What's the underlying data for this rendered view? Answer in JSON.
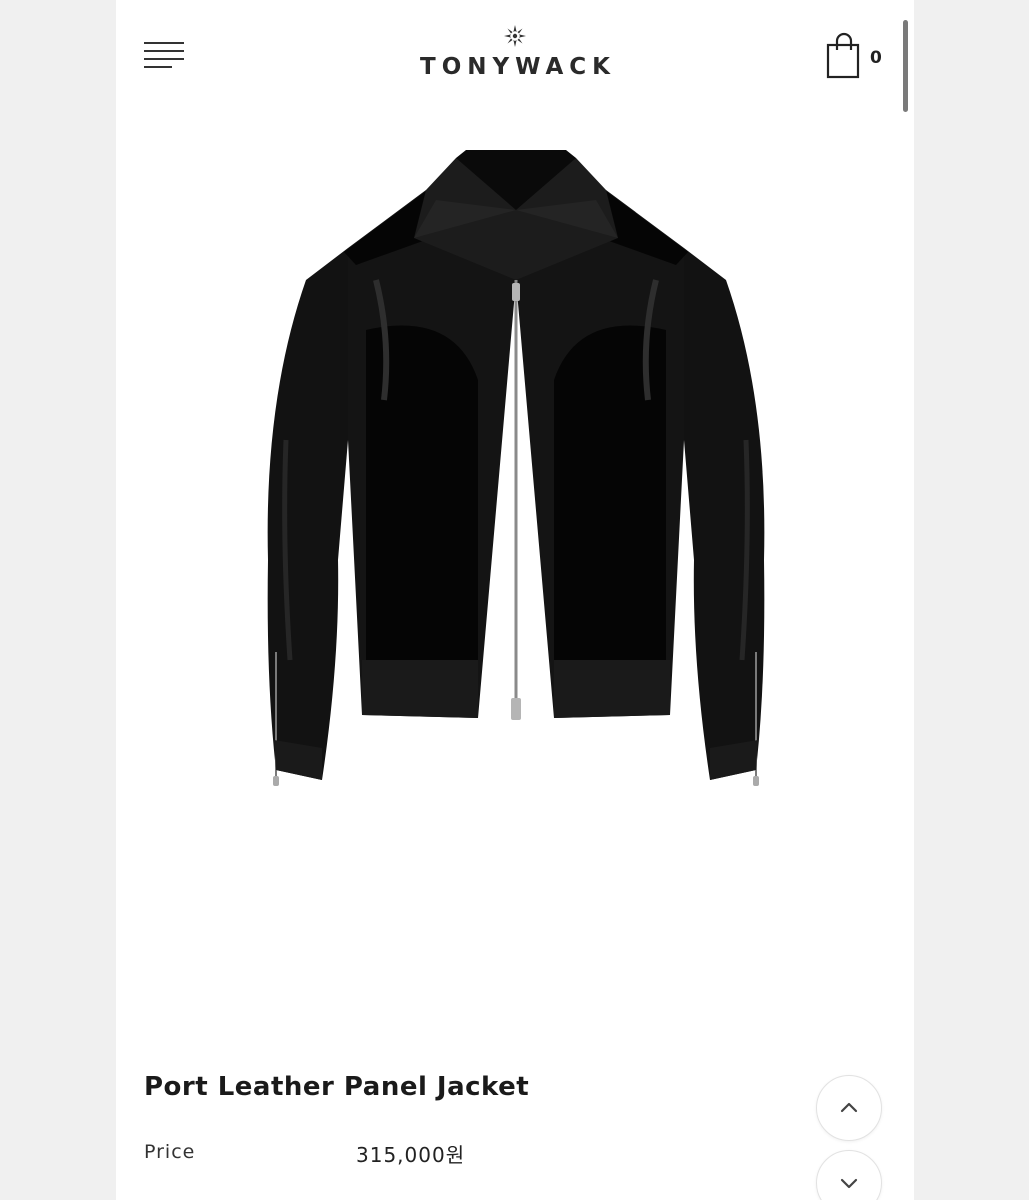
{
  "header": {
    "logo_text": "TONYWACK",
    "menu_icon": "hamburger-menu-icon",
    "cart_icon": "shopping-bag-icon",
    "cart_count": "0"
  },
  "product": {
    "image_icon": "jacket-image",
    "name": "Port Leather Panel Jacket",
    "price_label": "Price",
    "price_value": "315,000원"
  },
  "controls": {
    "scroll_up_icon": "chevron-up-icon",
    "scroll_down_icon": "chevron-down-icon"
  },
  "colors": {
    "background": "#ffffff",
    "outer_background": "#f0f0f0",
    "text": "#1a1a1a",
    "jacket": "#0d0d0d"
  }
}
